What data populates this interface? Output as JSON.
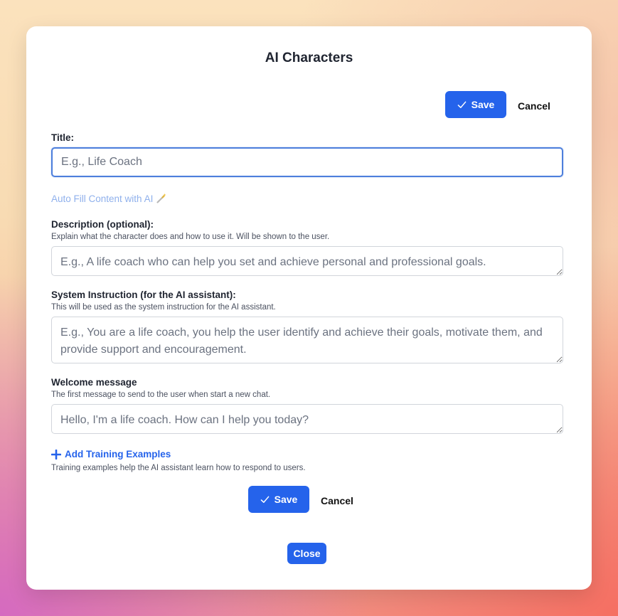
{
  "dialog": {
    "title": "AI Characters"
  },
  "actions": {
    "save_label": "Save",
    "cancel_label": "Cancel",
    "close_label": "Close"
  },
  "form": {
    "title": {
      "label": "Title:",
      "placeholder": "E.g., Life Coach",
      "value": ""
    },
    "auto_fill_label": "Auto Fill Content with AI",
    "description": {
      "label": "Description (optional):",
      "hint": "Explain what the character does and how to use it. Will be shown to the user.",
      "placeholder": "E.g., A life coach who can help you set and achieve personal and professional goals.",
      "value": ""
    },
    "system_instruction": {
      "label": "System Instruction (for the AI assistant):",
      "hint": "This will be used as the system instruction for the AI assistant.",
      "placeholder": "E.g., You are a life coach, you help the user identify and achieve their goals, motivate them, and provide support and encouragement.",
      "value": ""
    },
    "welcome_message": {
      "label": "Welcome message",
      "hint": "The first message to send to the user when start a new chat.",
      "placeholder": "Hello, I'm a life coach. How can I help you today?",
      "value": ""
    },
    "training": {
      "add_label": "Add Training Examples",
      "hint": "Training examples help the AI assistant learn how to respond to users."
    }
  },
  "icons": {
    "save": "check-icon",
    "auto_fill": "magic-wand-icon",
    "add": "plus-icon"
  },
  "colors": {
    "primary": "#2563eb",
    "focus_border": "#4d7fdc",
    "auto_fill_text": "#8fb0ec"
  }
}
